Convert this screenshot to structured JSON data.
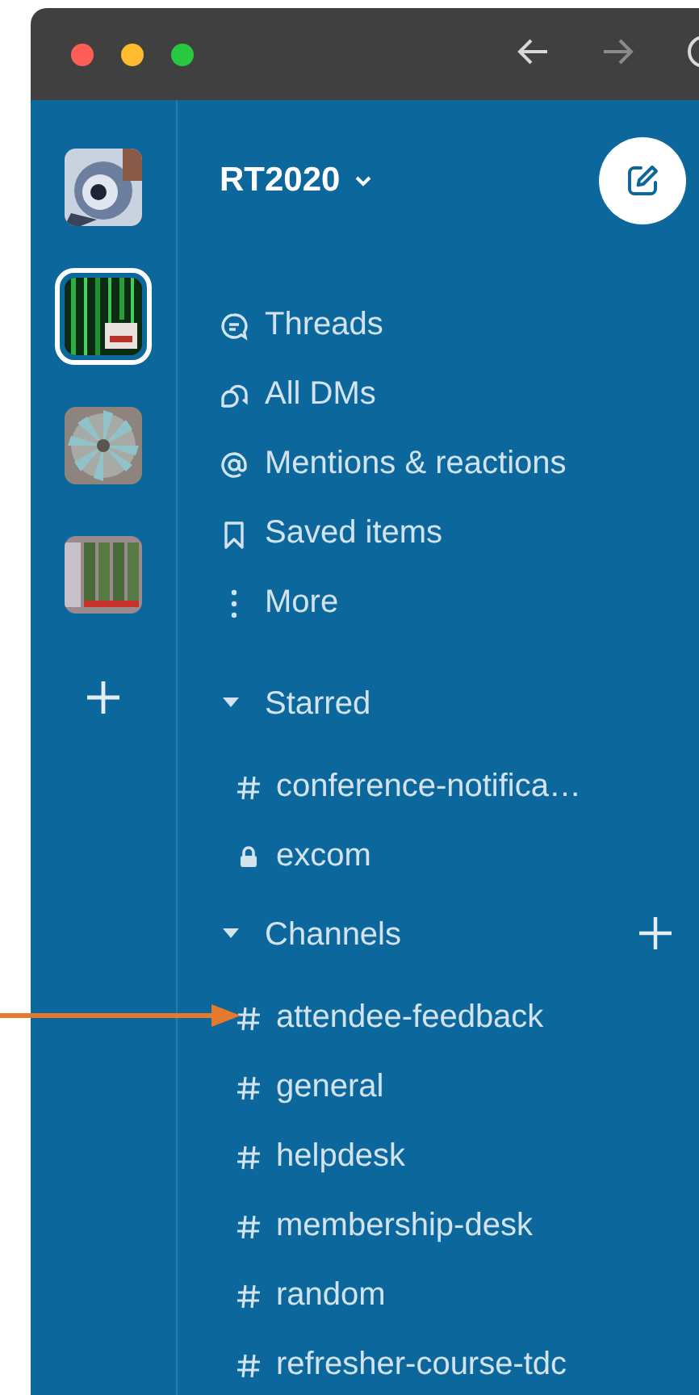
{
  "title_bar": {
    "traffic_lights": [
      {
        "kind": "close"
      },
      {
        "kind": "minimize"
      },
      {
        "kind": "maximize"
      }
    ],
    "nav": [
      {
        "kind": "back",
        "disabled": false
      },
      {
        "kind": "forward",
        "disabled": true
      },
      {
        "kind": "history",
        "disabled": false
      }
    ]
  },
  "workspaces": [
    {
      "kind": "picture",
      "selected": false
    },
    {
      "kind": "picture",
      "selected": true
    },
    {
      "kind": "picture",
      "selected": false
    },
    {
      "kind": "picture",
      "selected": false
    }
  ],
  "workspace_name": "RT2020",
  "nav_items": [
    {
      "kind": "threads",
      "label": "Threads"
    },
    {
      "kind": "dms",
      "label": "All DMs"
    },
    {
      "kind": "mentions",
      "label": "Mentions & reactions"
    },
    {
      "kind": "saved",
      "label": "Saved items"
    },
    {
      "kind": "more",
      "label": "More"
    }
  ],
  "sections": [
    {
      "title": "Starred",
      "expanded": true,
      "can_add": false,
      "channels": [
        {
          "kind": "public",
          "name": "conference-notifica…"
        },
        {
          "kind": "private",
          "name": "excom"
        }
      ]
    },
    {
      "title": "Channels",
      "expanded": true,
      "can_add": true,
      "channels": [
        {
          "kind": "public",
          "name": "attendee-feedback"
        },
        {
          "kind": "public",
          "name": "general"
        },
        {
          "kind": "public",
          "name": "helpdesk"
        },
        {
          "kind": "public",
          "name": "membership-desk"
        },
        {
          "kind": "public",
          "name": "random"
        },
        {
          "kind": "public",
          "name": "refresher-course-tdc"
        }
      ]
    }
  ]
}
